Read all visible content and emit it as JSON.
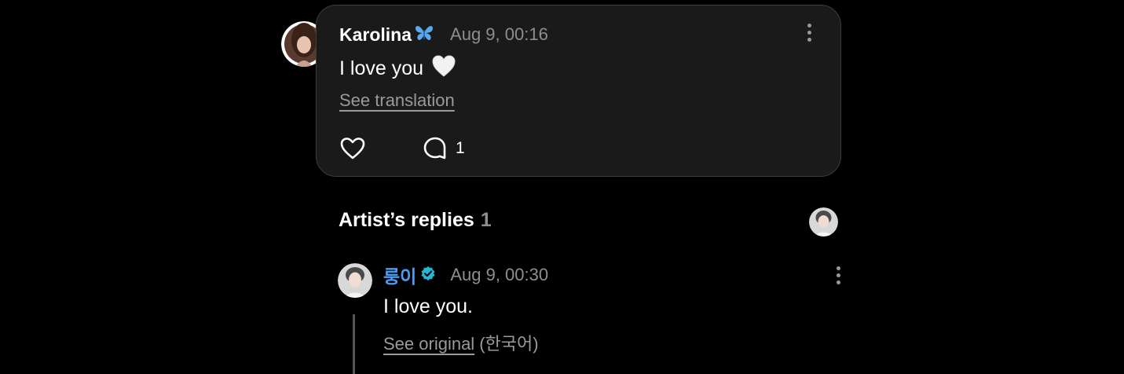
{
  "comment": {
    "author": "Karolina",
    "author_emoji": "butterfly-emoji",
    "timestamp": "Aug 9, 00:16",
    "text": "I love you",
    "text_emoji": "white-heart-emoji",
    "see_translation": "See translation",
    "reply_count": "1"
  },
  "artist_replies": {
    "title": "Artist’s replies",
    "count": "1",
    "reply": {
      "author": "룽이",
      "verified": true,
      "timestamp": "Aug 9, 00:30",
      "text": "I love you.",
      "see_original": "See original",
      "language": "(한국어)"
    }
  },
  "colors": {
    "background": "#000000",
    "card": "#1a1a1a",
    "card_border": "#3c3c3c",
    "artist_name": "#4a9cf5",
    "verified_badge": "#22b8d6",
    "muted_text": "#8e8e8e"
  },
  "icons": [
    "butterfly-emoji",
    "white-heart-emoji",
    "more-icon",
    "heart-icon",
    "comment-icon",
    "verified-icon"
  ]
}
